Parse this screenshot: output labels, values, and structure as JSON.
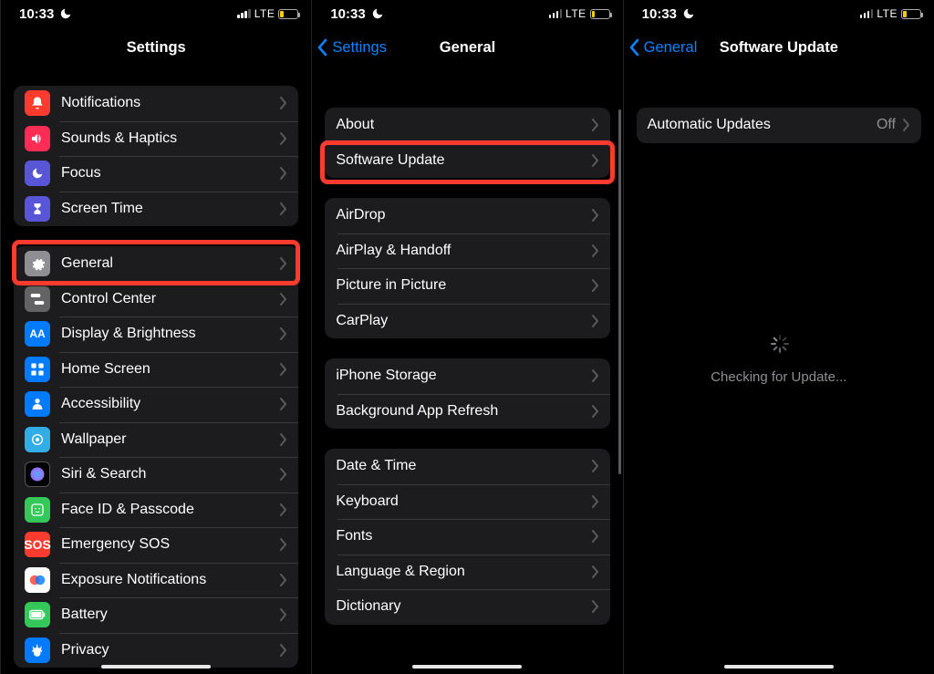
{
  "status": {
    "time": "10:33",
    "network": "LTE"
  },
  "screen1": {
    "title": "Settings",
    "group1": [
      {
        "icon": "bell",
        "label": "Notifications",
        "color": "ic-red"
      },
      {
        "icon": "speaker",
        "label": "Sounds & Haptics",
        "color": "ic-pink"
      },
      {
        "icon": "moon",
        "label": "Focus",
        "color": "ic-indigo"
      },
      {
        "icon": "hourglass",
        "label": "Screen Time",
        "color": "ic-hourglass"
      }
    ],
    "group2": [
      {
        "icon": "gear",
        "label": "General",
        "color": "ic-gray",
        "highlight": true
      },
      {
        "icon": "switches",
        "label": "Control Center",
        "color": "ic-darkgray"
      },
      {
        "icon": "aa",
        "label": "Display & Brightness",
        "color": "ic-blue"
      },
      {
        "icon": "grid",
        "label": "Home Screen",
        "color": "ic-blue2"
      },
      {
        "icon": "person",
        "label": "Accessibility",
        "color": "ic-blue"
      },
      {
        "icon": "flower",
        "label": "Wallpaper",
        "color": "ic-cyan"
      },
      {
        "icon": "siri",
        "label": "Siri & Search",
        "color": "ic-black"
      },
      {
        "icon": "face",
        "label": "Face ID & Passcode",
        "color": "ic-green"
      },
      {
        "icon": "sos",
        "label": "Emergency SOS",
        "color": "ic-sos"
      },
      {
        "icon": "exposure",
        "label": "Exposure Notifications",
        "color": "ic-exposure"
      },
      {
        "icon": "battery",
        "label": "Battery",
        "color": "ic-battery"
      },
      {
        "icon": "hand",
        "label": "Privacy",
        "color": "ic-hand"
      }
    ]
  },
  "screen2": {
    "back": "Settings",
    "title": "General",
    "groups": [
      [
        {
          "label": "About"
        },
        {
          "label": "Software Update",
          "highlight": true
        }
      ],
      [
        {
          "label": "AirDrop"
        },
        {
          "label": "AirPlay & Handoff"
        },
        {
          "label": "Picture in Picture"
        },
        {
          "label": "CarPlay"
        }
      ],
      [
        {
          "label": "iPhone Storage"
        },
        {
          "label": "Background App Refresh"
        }
      ],
      [
        {
          "label": "Date & Time"
        },
        {
          "label": "Keyboard"
        },
        {
          "label": "Fonts"
        },
        {
          "label": "Language & Region"
        },
        {
          "label": "Dictionary"
        }
      ]
    ]
  },
  "screen3": {
    "back": "General",
    "title": "Software Update",
    "row": {
      "label": "Automatic Updates",
      "value": "Off"
    },
    "checking": "Checking for Update..."
  }
}
